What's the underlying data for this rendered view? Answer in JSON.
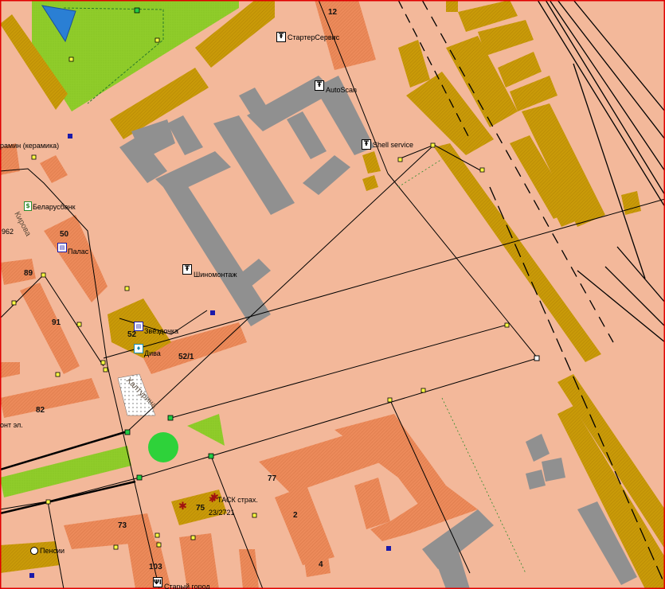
{
  "map": {
    "colors": {
      "background": "#f3b89a",
      "industrial": "#c99a08",
      "residential": "#ec8a5a",
      "grey_building": "#909090",
      "park": "#8fcc2a",
      "railway": "#000000",
      "water": "#2a7fd4",
      "frame": "#e00000"
    },
    "house_numbers": [
      "12",
      "50",
      "89",
      "91",
      "52",
      "52/1",
      "82",
      "77",
      "75",
      "2",
      "73",
      "103",
      "4"
    ],
    "streets": [
      "Кирова",
      "Халтурина"
    ],
    "pois": [
      {
        "icon": "tire-service-icon",
        "label": "СтартерСервис"
      },
      {
        "icon": "tire-service-icon",
        "label": "AutoScan"
      },
      {
        "icon": "tire-service-icon",
        "label": "Shell service"
      },
      {
        "icon": "tire-service-icon",
        "label": "Шиномонтаж"
      },
      {
        "icon": "bank-icon",
        "label": "Беларусбанк"
      },
      {
        "icon": "shop-icon",
        "label": "Палас"
      },
      {
        "icon": "shop-icon",
        "label": "Звёздочка"
      },
      {
        "icon": "shop-icon",
        "label": "Дива"
      },
      {
        "icon": "insurance-icon",
        "label": "ТАСК страх."
      },
      {
        "icon": "pension-icon",
        "label": "Пенсии"
      },
      {
        "icon": "food-icon",
        "label": "Старый город"
      }
    ],
    "extra_labels": {
      "ceramics": "рамин (керамика)",
      "house_962": "962",
      "repair": "онт эл.",
      "address_23": "23/2721"
    }
  }
}
